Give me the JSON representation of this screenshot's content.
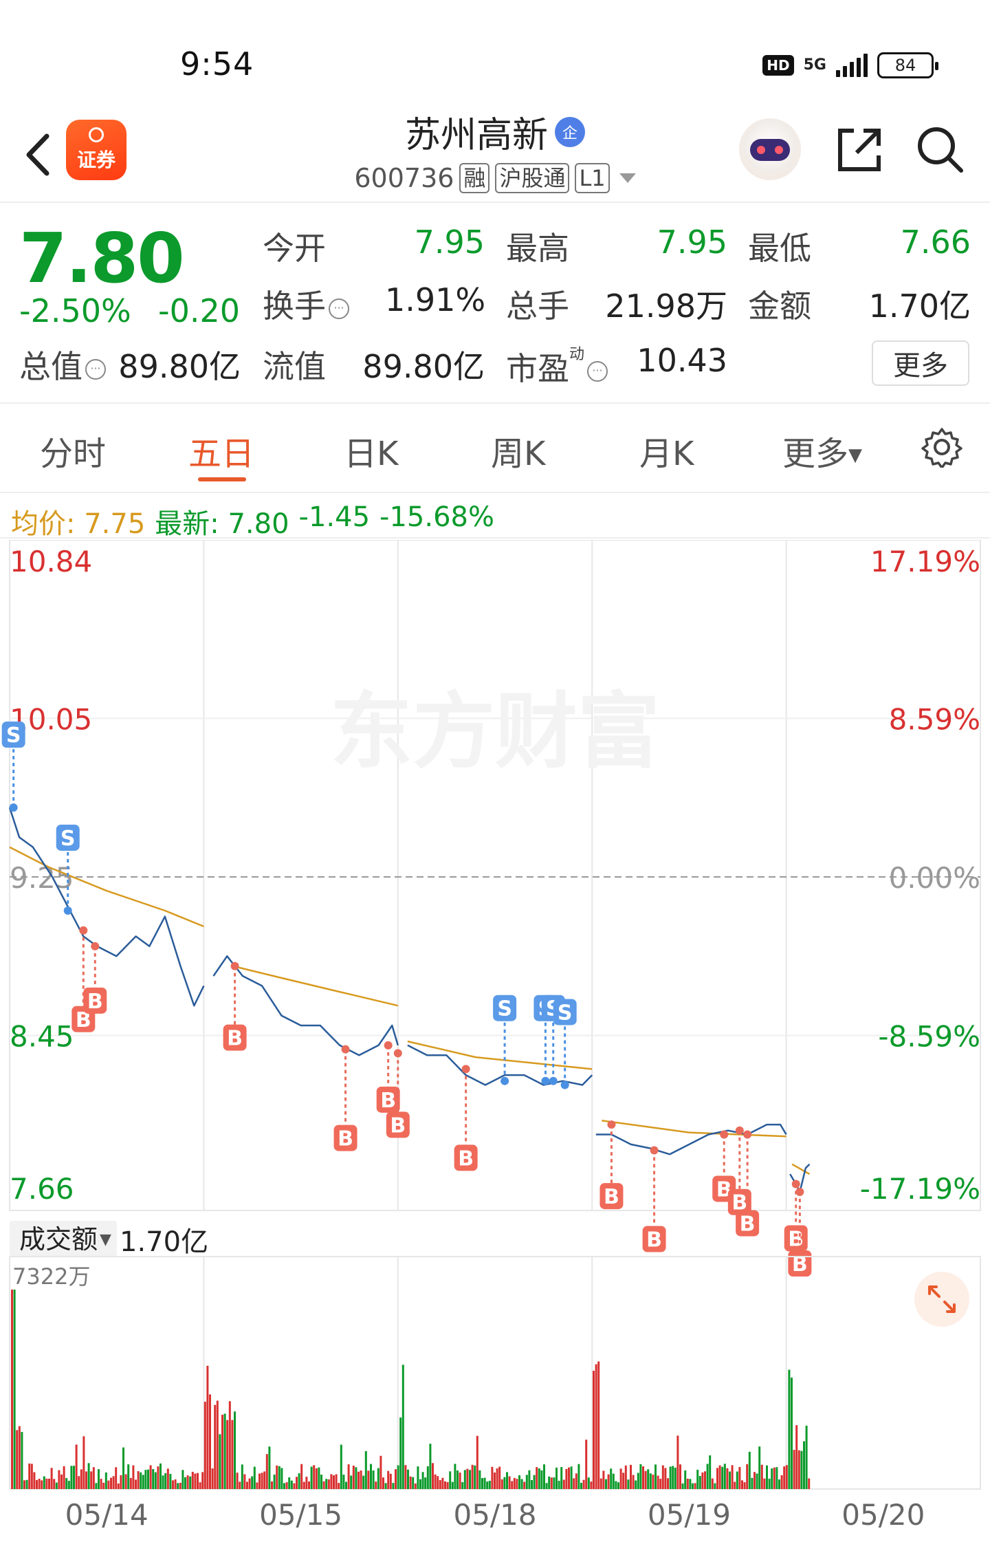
{
  "status_bar": {
    "time": "9:54",
    "network": "5G",
    "hd": "HD",
    "battery": "84"
  },
  "header": {
    "app_logo_text": "证券",
    "stock_name": "苏州高新",
    "qi_badge": "企",
    "code": "600736",
    "tags": [
      "融",
      "沪股通",
      "L1"
    ]
  },
  "quote": {
    "price": "7.80",
    "change_pct": "-2.50%",
    "change_abs": "-0.20",
    "stats": [
      {
        "label": "今开",
        "value": "7.95",
        "color": "#0b9a2b"
      },
      {
        "label": "最高",
        "value": "7.95",
        "color": "#0b9a2b"
      },
      {
        "label": "最低",
        "value": "7.66",
        "color": "#0b9a2b"
      },
      {
        "label": "换手",
        "value": "1.91%",
        "color": "#222222"
      },
      {
        "label": "总手",
        "value": "21.98万",
        "color": "#222222"
      },
      {
        "label": "金额",
        "value": "1.70亿",
        "color": "#222222"
      },
      {
        "label": "总值",
        "value": "89.80亿",
        "color": "#222222"
      },
      {
        "label": "流值",
        "value": "89.80亿",
        "color": "#222222"
      },
      {
        "label": "市盈",
        "value": "10.43",
        "color": "#222222"
      }
    ],
    "pe_superscript": "动",
    "more_label": "更多"
  },
  "tabs": [
    "分时",
    "五日",
    "日K",
    "周K",
    "月K",
    "更多"
  ],
  "active_tab": "五日",
  "avg_bar": {
    "avg_label": "均价:",
    "avg_value": "7.75",
    "latest_label": "最新:",
    "latest_value": "7.80",
    "chg_abs": "-1.45",
    "chg_pct": "-15.68%"
  },
  "volume_panel": {
    "indicator": "成交额",
    "amount": "1.70亿",
    "max_label": "7322万"
  },
  "watermark": "东方财富",
  "colors": {
    "up": "#d93030",
    "down": "#0b9a2b",
    "price_line": "#2a5c9a",
    "avg_line": "#d79a1f",
    "accent": "#e8592b",
    "buy_marker": "#e86a5a",
    "sell_marker": "#4a90e2"
  },
  "chart_data": {
    "type": "line",
    "x_labels": [
      "05/14",
      "05/15",
      "05/18",
      "05/19",
      "05/20"
    ],
    "y_ticks_left": [
      "10.84",
      "10.05",
      "9.25",
      "8.45",
      "7.66"
    ],
    "y_ticks_right": [
      "17.19%",
      "8.59%",
      "0.00%",
      "-8.59%",
      "-17.19%"
    ],
    "ylim": [
      7.66,
      10.84
    ],
    "reference_price": 9.25,
    "series": [
      {
        "name": "最新",
        "values": [
          [
            0.0,
            9.6
          ],
          [
            0.05,
            9.45
          ],
          [
            0.12,
            9.4
          ],
          [
            0.22,
            9.25
          ],
          [
            0.3,
            9.1
          ],
          [
            0.38,
            8.95
          ],
          [
            0.45,
            8.9
          ],
          [
            0.55,
            8.85
          ],
          [
            0.65,
            8.95
          ],
          [
            0.72,
            8.9
          ],
          [
            0.8,
            9.05
          ],
          [
            0.88,
            8.8
          ],
          [
            0.95,
            8.6
          ],
          [
            1.0,
            8.7
          ],
          [
            1.05,
            8.75
          ],
          [
            1.12,
            8.85
          ],
          [
            1.2,
            8.75
          ],
          [
            1.3,
            8.7
          ],
          [
            1.4,
            8.55
          ],
          [
            1.5,
            8.5
          ],
          [
            1.6,
            8.5
          ],
          [
            1.7,
            8.4
          ],
          [
            1.8,
            8.35
          ],
          [
            1.9,
            8.4
          ],
          [
            1.97,
            8.5
          ],
          [
            2.0,
            8.4
          ],
          [
            2.05,
            8.4
          ],
          [
            2.15,
            8.35
          ],
          [
            2.25,
            8.35
          ],
          [
            2.35,
            8.25
          ],
          [
            2.45,
            8.2
          ],
          [
            2.55,
            8.25
          ],
          [
            2.65,
            8.25
          ],
          [
            2.75,
            8.2
          ],
          [
            2.85,
            8.22
          ],
          [
            2.95,
            8.2
          ],
          [
            3.0,
            8.25
          ],
          [
            3.02,
            7.95
          ],
          [
            3.1,
            7.95
          ],
          [
            3.2,
            7.9
          ],
          [
            3.3,
            7.88
          ],
          [
            3.4,
            7.85
          ],
          [
            3.5,
            7.9
          ],
          [
            3.6,
            7.95
          ],
          [
            3.7,
            7.97
          ],
          [
            3.8,
            7.95
          ],
          [
            3.9,
            8.0
          ],
          [
            3.97,
            8.0
          ],
          [
            4.0,
            7.95
          ],
          [
            4.02,
            7.75
          ],
          [
            4.05,
            7.7
          ],
          [
            4.07,
            7.66
          ],
          [
            4.1,
            7.78
          ],
          [
            4.12,
            7.8
          ]
        ]
      },
      {
        "name": "均价",
        "values": [
          [
            0.0,
            9.4
          ],
          [
            0.2,
            9.3
          ],
          [
            0.5,
            9.18
          ],
          [
            0.8,
            9.08
          ],
          [
            1.0,
            9.0
          ],
          [
            1.15,
            8.8
          ],
          [
            1.4,
            8.74
          ],
          [
            1.7,
            8.67
          ],
          [
            2.0,
            8.6
          ],
          [
            2.05,
            8.42
          ],
          [
            2.4,
            8.34
          ],
          [
            2.8,
            8.3
          ],
          [
            3.0,
            8.28
          ],
          [
            3.05,
            8.02
          ],
          [
            3.5,
            7.96
          ],
          [
            4.0,
            7.94
          ],
          [
            4.03,
            7.8
          ],
          [
            4.12,
            7.75
          ]
        ]
      }
    ],
    "trade_markers": [
      {
        "type": "S",
        "x": 0.02,
        "price": 9.6
      },
      {
        "type": "S",
        "x": 0.3,
        "price": 9.08
      },
      {
        "type": "B",
        "x": 0.38,
        "price": 8.98
      },
      {
        "type": "B",
        "x": 0.44,
        "price": 8.9
      },
      {
        "type": "B",
        "x": 1.16,
        "price": 8.8
      },
      {
        "type": "B",
        "x": 1.73,
        "price": 8.38
      },
      {
        "type": "B",
        "x": 1.95,
        "price": 8.4
      },
      {
        "type": "B",
        "x": 2.0,
        "price": 8.36
      },
      {
        "type": "B",
        "x": 2.35,
        "price": 8.28
      },
      {
        "type": "S",
        "x": 2.55,
        "price": 8.22
      },
      {
        "type": "S",
        "x": 2.76,
        "price": 8.22
      },
      {
        "type": "S",
        "x": 2.8,
        "price": 8.22
      },
      {
        "type": "S",
        "x": 2.86,
        "price": 8.2
      },
      {
        "type": "B",
        "x": 3.1,
        "price": 8.0
      },
      {
        "type": "B",
        "x": 3.32,
        "price": 7.87
      },
      {
        "type": "B",
        "x": 3.68,
        "price": 7.95
      },
      {
        "type": "B",
        "x": 3.76,
        "price": 7.97
      },
      {
        "type": "B",
        "x": 3.8,
        "price": 7.95
      },
      {
        "type": "B",
        "x": 4.05,
        "price": 7.7
      },
      {
        "type": "B",
        "x": 4.07,
        "price": 7.66
      }
    ]
  }
}
